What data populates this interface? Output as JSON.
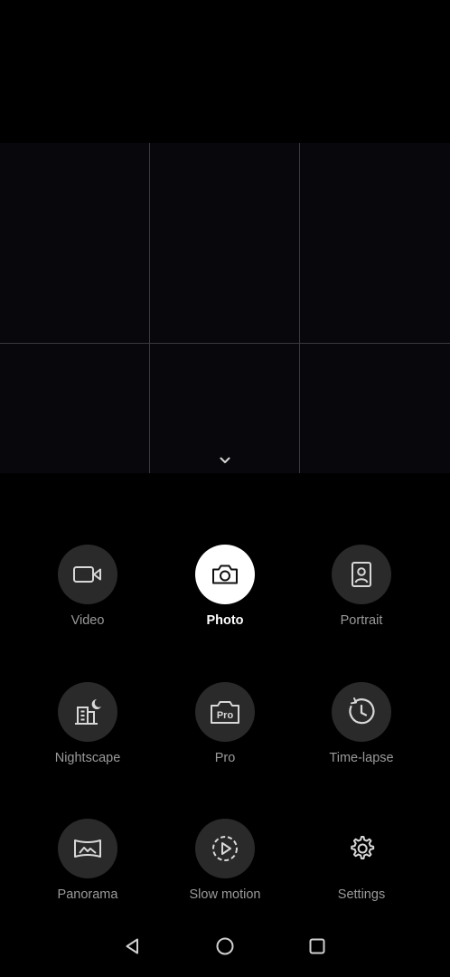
{
  "viewfinder": {
    "collapse_icon": "chevron-down-icon"
  },
  "modes": [
    {
      "id": "video",
      "label": "Video",
      "icon": "video-camera-icon",
      "active": false
    },
    {
      "id": "photo",
      "label": "Photo",
      "icon": "camera-icon",
      "active": true
    },
    {
      "id": "portrait",
      "label": "Portrait",
      "icon": "portrait-icon",
      "active": false
    },
    {
      "id": "nightscape",
      "label": "Nightscape",
      "icon": "nightscape-icon",
      "active": false
    },
    {
      "id": "pro",
      "label": "Pro",
      "icon": "pro-camera-icon",
      "active": false
    },
    {
      "id": "timelapse",
      "label": "Time-lapse",
      "icon": "timelapse-icon",
      "active": false
    },
    {
      "id": "panorama",
      "label": "Panorama",
      "icon": "panorama-icon",
      "active": false
    },
    {
      "id": "slowmotion",
      "label": "Slow motion",
      "icon": "slow-motion-icon",
      "active": false
    },
    {
      "id": "settings",
      "label": "Settings",
      "icon": "gear-icon",
      "active": false
    }
  ],
  "navigation": {
    "back_icon": "back-triangle-icon",
    "home_icon": "home-circle-icon",
    "recents_icon": "recents-square-icon"
  },
  "colors": {
    "background": "#000000",
    "mode_circle": "#2a2a2a",
    "active_circle": "#ffffff",
    "label": "#9a9a9a",
    "active_label": "#ffffff"
  }
}
